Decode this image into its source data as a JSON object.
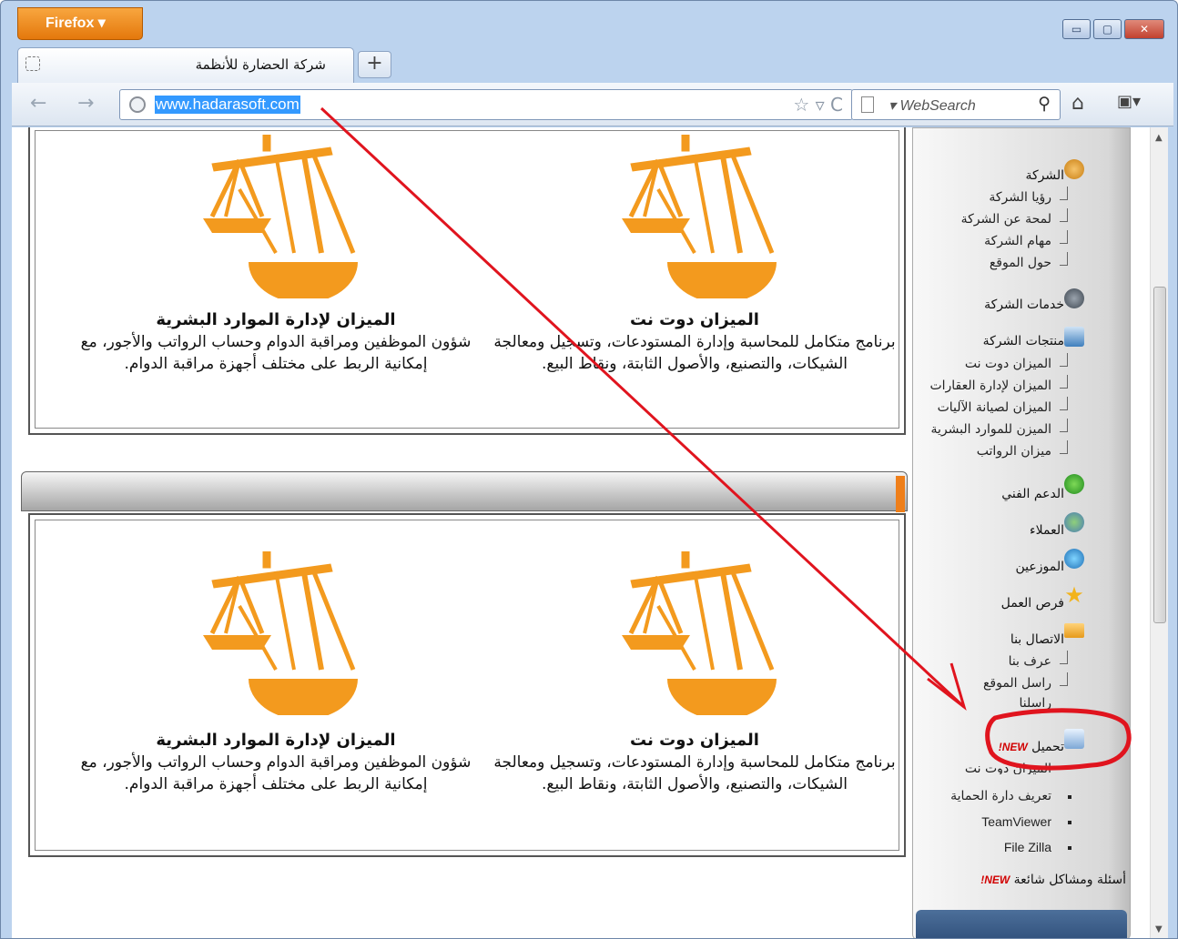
{
  "window": {
    "firefox_label": "Firefox ▾",
    "minimize": "▭",
    "maximize": "▢",
    "close": "✕"
  },
  "tabs": [
    {
      "title": "شركة الحضارة للأنظمة"
    }
  ],
  "newtab_label": "+",
  "navbar": {
    "back_icon": "←",
    "forward_icon": "→",
    "url": "www.hadarasoft.com",
    "url_icons": "☆ ▿ C",
    "search_placeholder": "▾ WebSearch",
    "search_icon": "⚲",
    "home_icon": "⌂",
    "bookmarks_icon": "▣▾"
  },
  "products": {
    "row1": [
      {
        "title": "الميزان دوت نت",
        "desc": "برنامج متكامل للمحاسبة وإدارة المستودعات، وتسجيل ومعالجة الشيكات، والتصنيع، والأصول الثابتة، ونقاط البيع."
      },
      {
        "title": "الميزان لإدارة الموارد البشرية",
        "desc": "شؤون الموظفين ومراقبة الدوام وحساب الرواتب والأجور، مع إمكانية الربط على مختلف أجهزة مراقبة الدوام."
      }
    ],
    "row2": [
      {
        "title": "الميزان دوت نت",
        "desc": "برنامج متكامل للمحاسبة وإدارة المستودعات، وتسجيل ومعالجة الشيكات، والتصنيع، والأصول الثابتة، ونقاط البيع."
      },
      {
        "title": "الميزان لإدارة الموارد البشرية",
        "desc": "شؤون الموظفين ومراقبة الدوام وحساب الرواتب والأجور، مع إمكانية الربط على مختلف أجهزة مراقبة الدوام."
      }
    ]
  },
  "sidebar": {
    "company": "الشركة",
    "company_items": [
      "رؤيا الشركة",
      "لمحة عن الشركة",
      "مهام الشركة",
      "حول الموقع"
    ],
    "services": "خدمات الشركة",
    "products": "منتجات الشركة",
    "product_items": [
      "الميزان دوت نت",
      "الميزان لإدارة العقارات",
      "الميزان لصيانة الآليات",
      "الميزن للموارد البشرية",
      "ميزان الرواتب"
    ],
    "support": "الدعم الفني",
    "clients": "العملاء",
    "distributors": "الموزعين",
    "jobs": "فرص العمل",
    "contact": "الاتصال بنا",
    "contact_items": [
      "عرف بنا",
      "راسل الموقع",
      "راسلنا"
    ],
    "download": "تحميل",
    "new_badge": "NEW!",
    "download_items": [
      "الميزان دوت نت",
      "تعريف دارة الحماية",
      "TeamViewer",
      "File Zilla"
    ],
    "faq": "أسئلة ومشاكل شائعة",
    "faq_badge": "NEW!"
  },
  "colors": {
    "accent": "#f39a1e",
    "annotation": "#e0141e",
    "url_highlight": "#3399ff"
  }
}
